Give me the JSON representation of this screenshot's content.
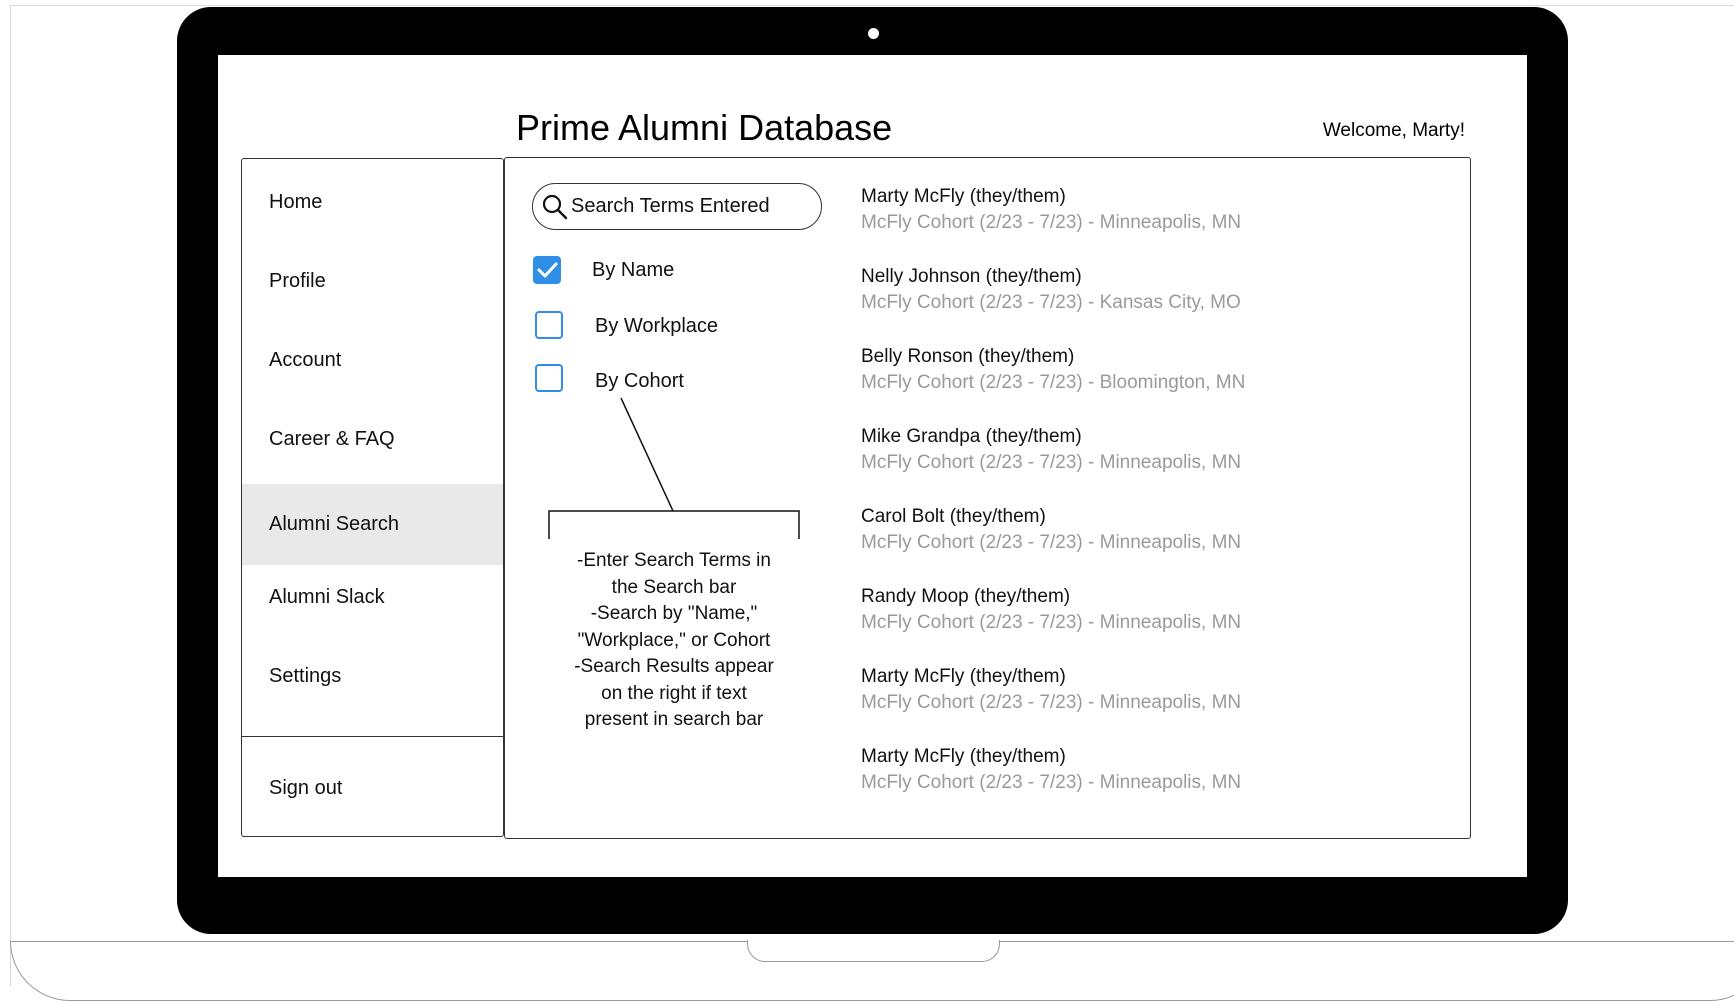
{
  "app": {
    "title": "Prime Alumni Database",
    "welcome": "Welcome, Marty!"
  },
  "sidebar": {
    "items": [
      {
        "label": "Home"
      },
      {
        "label": "Profile"
      },
      {
        "label": "Account"
      },
      {
        "label": "Career & FAQ"
      },
      {
        "label": "Alumni Search",
        "active": true
      },
      {
        "label": "Alumni Slack"
      },
      {
        "label": "Settings"
      }
    ],
    "sign_out": "Sign out"
  },
  "search": {
    "value": "Search Terms Entered",
    "icon": "search-icon"
  },
  "filters": [
    {
      "label": "By Name",
      "checked": true
    },
    {
      "label": "By Workplace",
      "checked": false
    },
    {
      "label": "By Cohort",
      "checked": false
    }
  ],
  "callout": {
    "lines": [
      "-Enter Search Terms in",
      "the Search bar",
      "-Search by \"Name,\"",
      "\"Workplace,\" or Cohort",
      "-Search Results appear",
      "on the right if text",
      "present in search bar"
    ]
  },
  "results": [
    {
      "name": "Marty McFly (they/them)",
      "detail": "McFly Cohort (2/23 - 7/23) - Minneapolis, MN"
    },
    {
      "name": "Nelly Johnson (they/them)",
      "detail": "McFly Cohort (2/23 - 7/23) - Kansas City, MO"
    },
    {
      "name": "Belly Ronson (they/them)",
      "detail": "McFly Cohort (2/23 - 7/23) - Bloomington, MN"
    },
    {
      "name": "Mike Grandpa (they/them)",
      "detail": "McFly Cohort (2/23 - 7/23) - Minneapolis, MN"
    },
    {
      "name": "Carol Bolt (they/them)",
      "detail": "McFly Cohort (2/23 - 7/23) - Minneapolis, MN"
    },
    {
      "name": "Randy Moop (they/them)",
      "detail": "McFly Cohort (2/23 - 7/23) - Minneapolis, MN"
    },
    {
      "name": "Marty McFly (they/them)",
      "detail": "McFly Cohort (2/23 - 7/23) - Minneapolis, MN"
    },
    {
      "name": "Marty McFly (they/them)",
      "detail": "McFly Cohort (2/23 - 7/23) - Minneapolis, MN"
    }
  ],
  "colors": {
    "checkbox_accent": "#2f8fe6",
    "active_nav_bg": "#e9e9e9",
    "detail_text": "#9a9a9a"
  }
}
